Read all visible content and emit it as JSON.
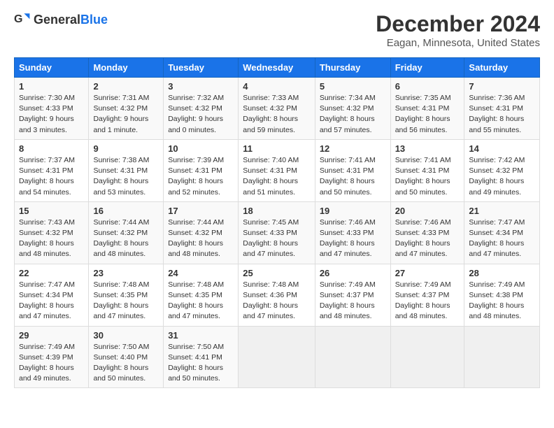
{
  "header": {
    "logo_general": "General",
    "logo_blue": "Blue",
    "main_title": "December 2024",
    "subtitle": "Eagan, Minnesota, United States"
  },
  "calendar": {
    "headers": [
      "Sunday",
      "Monday",
      "Tuesday",
      "Wednesday",
      "Thursday",
      "Friday",
      "Saturday"
    ],
    "weeks": [
      [
        {
          "day": "",
          "detail": ""
        },
        {
          "day": "2",
          "detail": "Sunrise: 7:31 AM\nSunset: 4:32 PM\nDaylight: 9 hours\nand 1 minute."
        },
        {
          "day": "3",
          "detail": "Sunrise: 7:32 AM\nSunset: 4:32 PM\nDaylight: 9 hours\nand 0 minutes."
        },
        {
          "day": "4",
          "detail": "Sunrise: 7:33 AM\nSunset: 4:32 PM\nDaylight: 8 hours\nand 59 minutes."
        },
        {
          "day": "5",
          "detail": "Sunrise: 7:34 AM\nSunset: 4:32 PM\nDaylight: 8 hours\nand 57 minutes."
        },
        {
          "day": "6",
          "detail": "Sunrise: 7:35 AM\nSunset: 4:31 PM\nDaylight: 8 hours\nand 56 minutes."
        },
        {
          "day": "7",
          "detail": "Sunrise: 7:36 AM\nSunset: 4:31 PM\nDaylight: 8 hours\nand 55 minutes."
        }
      ],
      [
        {
          "day": "1",
          "detail": "Sunrise: 7:30 AM\nSunset: 4:33 PM\nDaylight: 9 hours\nand 3 minutes."
        },
        {
          "day": "",
          "detail": ""
        },
        {
          "day": "",
          "detail": ""
        },
        {
          "day": "",
          "detail": ""
        },
        {
          "day": "",
          "detail": ""
        },
        {
          "day": "",
          "detail": ""
        },
        {
          "day": "",
          "detail": ""
        }
      ],
      [
        {
          "day": "8",
          "detail": "Sunrise: 7:37 AM\nSunset: 4:31 PM\nDaylight: 8 hours\nand 54 minutes."
        },
        {
          "day": "9",
          "detail": "Sunrise: 7:38 AM\nSunset: 4:31 PM\nDaylight: 8 hours\nand 53 minutes."
        },
        {
          "day": "10",
          "detail": "Sunrise: 7:39 AM\nSunset: 4:31 PM\nDaylight: 8 hours\nand 52 minutes."
        },
        {
          "day": "11",
          "detail": "Sunrise: 7:40 AM\nSunset: 4:31 PM\nDaylight: 8 hours\nand 51 minutes."
        },
        {
          "day": "12",
          "detail": "Sunrise: 7:41 AM\nSunset: 4:31 PM\nDaylight: 8 hours\nand 50 minutes."
        },
        {
          "day": "13",
          "detail": "Sunrise: 7:41 AM\nSunset: 4:31 PM\nDaylight: 8 hours\nand 50 minutes."
        },
        {
          "day": "14",
          "detail": "Sunrise: 7:42 AM\nSunset: 4:32 PM\nDaylight: 8 hours\nand 49 minutes."
        }
      ],
      [
        {
          "day": "15",
          "detail": "Sunrise: 7:43 AM\nSunset: 4:32 PM\nDaylight: 8 hours\nand 48 minutes."
        },
        {
          "day": "16",
          "detail": "Sunrise: 7:44 AM\nSunset: 4:32 PM\nDaylight: 8 hours\nand 48 minutes."
        },
        {
          "day": "17",
          "detail": "Sunrise: 7:44 AM\nSunset: 4:32 PM\nDaylight: 8 hours\nand 48 minutes."
        },
        {
          "day": "18",
          "detail": "Sunrise: 7:45 AM\nSunset: 4:33 PM\nDaylight: 8 hours\nand 47 minutes."
        },
        {
          "day": "19",
          "detail": "Sunrise: 7:46 AM\nSunset: 4:33 PM\nDaylight: 8 hours\nand 47 minutes."
        },
        {
          "day": "20",
          "detail": "Sunrise: 7:46 AM\nSunset: 4:33 PM\nDaylight: 8 hours\nand 47 minutes."
        },
        {
          "day": "21",
          "detail": "Sunrise: 7:47 AM\nSunset: 4:34 PM\nDaylight: 8 hours\nand 47 minutes."
        }
      ],
      [
        {
          "day": "22",
          "detail": "Sunrise: 7:47 AM\nSunset: 4:34 PM\nDaylight: 8 hours\nand 47 minutes."
        },
        {
          "day": "23",
          "detail": "Sunrise: 7:48 AM\nSunset: 4:35 PM\nDaylight: 8 hours\nand 47 minutes."
        },
        {
          "day": "24",
          "detail": "Sunrise: 7:48 AM\nSunset: 4:35 PM\nDaylight: 8 hours\nand 47 minutes."
        },
        {
          "day": "25",
          "detail": "Sunrise: 7:48 AM\nSunset: 4:36 PM\nDaylight: 8 hours\nand 47 minutes."
        },
        {
          "day": "26",
          "detail": "Sunrise: 7:49 AM\nSunset: 4:37 PM\nDaylight: 8 hours\nand 48 minutes."
        },
        {
          "day": "27",
          "detail": "Sunrise: 7:49 AM\nSunset: 4:37 PM\nDaylight: 8 hours\nand 48 minutes."
        },
        {
          "day": "28",
          "detail": "Sunrise: 7:49 AM\nSunset: 4:38 PM\nDaylight: 8 hours\nand 48 minutes."
        }
      ],
      [
        {
          "day": "29",
          "detail": "Sunrise: 7:49 AM\nSunset: 4:39 PM\nDaylight: 8 hours\nand 49 minutes."
        },
        {
          "day": "30",
          "detail": "Sunrise: 7:50 AM\nSunset: 4:40 PM\nDaylight: 8 hours\nand 50 minutes."
        },
        {
          "day": "31",
          "detail": "Sunrise: 7:50 AM\nSunset: 4:41 PM\nDaylight: 8 hours\nand 50 minutes."
        },
        {
          "day": "",
          "detail": ""
        },
        {
          "day": "",
          "detail": ""
        },
        {
          "day": "",
          "detail": ""
        },
        {
          "day": "",
          "detail": ""
        }
      ]
    ]
  }
}
